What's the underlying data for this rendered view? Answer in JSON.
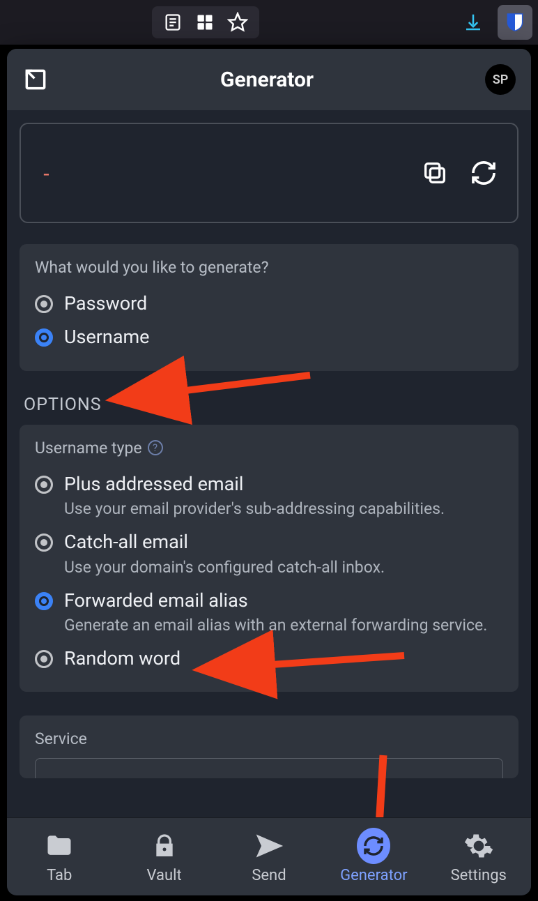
{
  "header": {
    "title": "Generator",
    "avatar_initials": "SP"
  },
  "generated": {
    "value": "-"
  },
  "generate_type": {
    "question": "What would you like to generate?",
    "options": {
      "password": "Password",
      "username": "Username"
    },
    "selected": "username"
  },
  "options_heading": "OPTIONS",
  "username_type": {
    "label": "Username type",
    "options": [
      {
        "key": "plus",
        "label": "Plus addressed email",
        "desc": "Use your email provider's sub-addressing capabilities."
      },
      {
        "key": "catchall",
        "label": "Catch-all email",
        "desc": "Use your domain's configured catch-all inbox."
      },
      {
        "key": "forwarded",
        "label": "Forwarded email alias",
        "desc": "Generate an email alias with an external forwarding service."
      },
      {
        "key": "random",
        "label": "Random word",
        "desc": ""
      }
    ],
    "selected": "forwarded"
  },
  "service": {
    "label": "Service"
  },
  "tabs": {
    "tab": "Tab",
    "vault": "Vault",
    "send": "Send",
    "generator": "Generator",
    "settings": "Settings",
    "active": "generator"
  }
}
